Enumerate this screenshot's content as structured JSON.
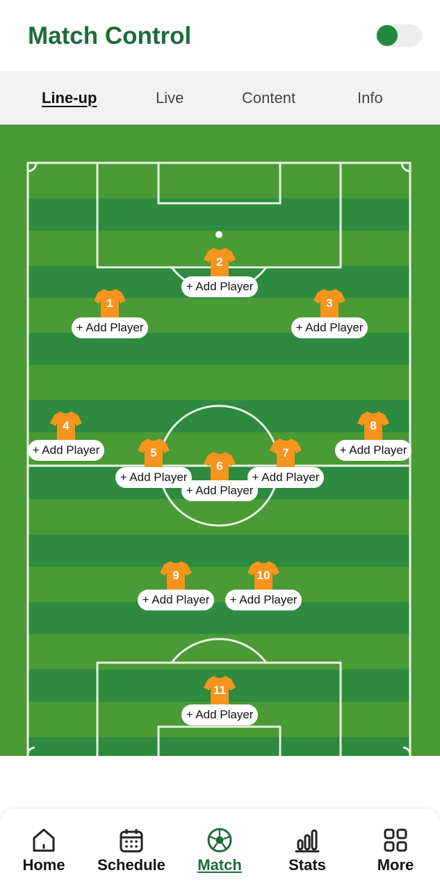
{
  "header": {
    "title": "Match Control",
    "toggle_on": true
  },
  "tabs": [
    {
      "label": "Line-up",
      "active": true
    },
    {
      "label": "Live",
      "active": false
    },
    {
      "label": "Content",
      "active": false
    },
    {
      "label": "Info",
      "active": false
    }
  ],
  "players": [
    {
      "number": "1",
      "action": "+ Add Player"
    },
    {
      "number": "2",
      "action": "+ Add Player"
    },
    {
      "number": "3",
      "action": "+ Add Player"
    },
    {
      "number": "4",
      "action": "+ Add Player"
    },
    {
      "number": "5",
      "action": "+ Add Player"
    },
    {
      "number": "6",
      "action": "+ Add Player"
    },
    {
      "number": "7",
      "action": "+ Add Player"
    },
    {
      "number": "8",
      "action": "+ Add Player"
    },
    {
      "number": "9",
      "action": "+ Add Player"
    },
    {
      "number": "10",
      "action": "+ Add Player"
    },
    {
      "number": "11",
      "action": "+ Add Player"
    }
  ],
  "nav": [
    {
      "label": "Home",
      "icon": "home-icon"
    },
    {
      "label": "Schedule",
      "icon": "calendar-icon"
    },
    {
      "label": "Match",
      "icon": "soccer-ball-icon",
      "active": true
    },
    {
      "label": "Stats",
      "icon": "bar-chart-icon"
    },
    {
      "label": "More",
      "icon": "grid-icon"
    }
  ],
  "colors": {
    "brand": "#1e6b3a",
    "pitch_light": "#4a9a35",
    "pitch_dark": "#2e8a3e",
    "shirt": "#f7941d"
  }
}
